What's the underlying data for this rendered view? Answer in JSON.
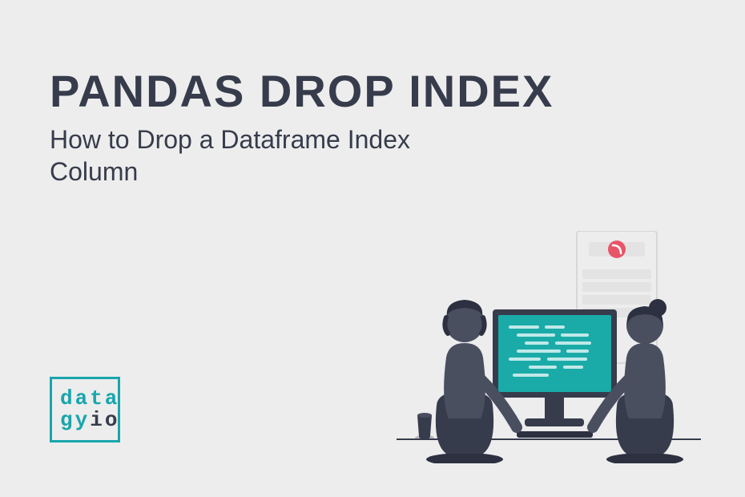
{
  "title": "PANDAS DROP INDEX",
  "subtitle": "How to Drop a Dataframe Index Column",
  "logo": {
    "line1": "data",
    "line2a": "gy",
    "line2b": "io"
  },
  "colors": {
    "background": "#ededed",
    "text": "#373c4c",
    "accent": "#18a6ac",
    "screen": "#1aaba8",
    "pink": "#e85569"
  }
}
